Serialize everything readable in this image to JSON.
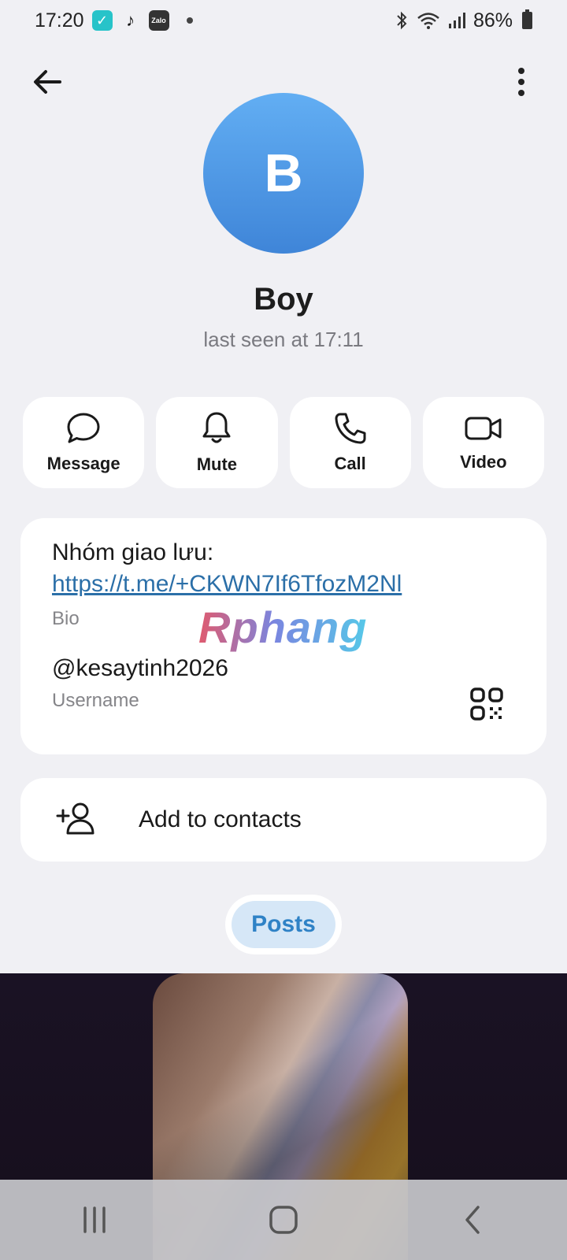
{
  "status_bar": {
    "time": "17:20",
    "badge_zalo": "Zalo",
    "battery": "86%"
  },
  "profile": {
    "avatar_letter": "B",
    "name": "Boy",
    "last_seen": "last seen at 17:11",
    "avatar_color": "#4f96e6"
  },
  "actions": [
    {
      "label": "Message",
      "icon": "chat-bubble-icon"
    },
    {
      "label": "Mute",
      "icon": "bell-icon"
    },
    {
      "label": "Call",
      "icon": "phone-icon"
    },
    {
      "label": "Video",
      "icon": "video-camera-icon"
    }
  ],
  "info": {
    "bio_text": "Nhóm giao lưu:",
    "bio_link": "https://t.me/+CKWN7If6TfozM2Nl",
    "bio_label": "Bio",
    "watermark": "Rphang",
    "username": "@kesaytinh2026",
    "username_label": "Username"
  },
  "contacts": {
    "add_label": "Add to contacts"
  },
  "tabs": {
    "posts": "Posts"
  },
  "colors": {
    "link": "#2b6fa8",
    "accent": "#2f82c6",
    "background": "#f0f0f4"
  }
}
